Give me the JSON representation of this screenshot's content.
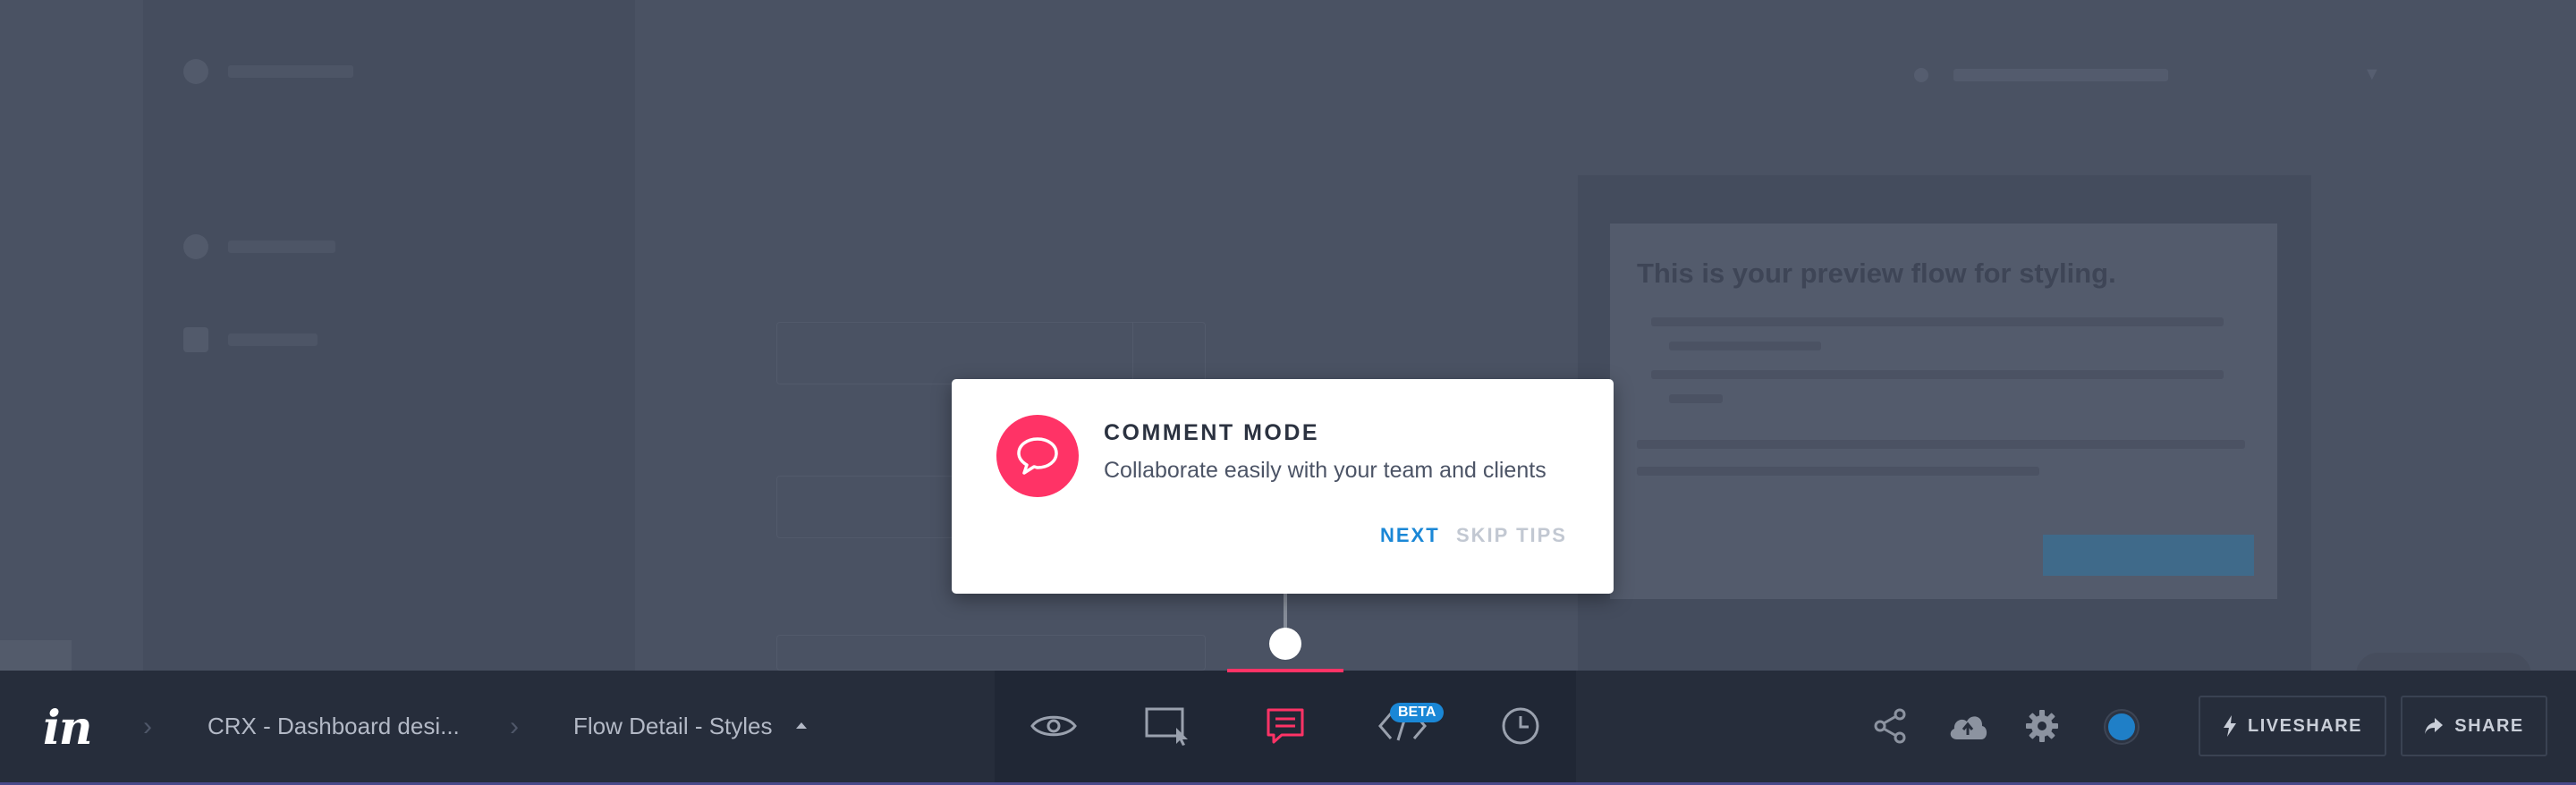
{
  "toolbar": {
    "logo": "in",
    "breadcrumb": {
      "project": "CRX - Dashboard desi...",
      "screen": "Flow Detail - Styles"
    },
    "modes": [
      {
        "name": "preview-mode",
        "icon": "eye-icon"
      },
      {
        "name": "build-mode",
        "icon": "hotspot-icon"
      },
      {
        "name": "comment-mode",
        "icon": "comment-icon",
        "active": true
      },
      {
        "name": "inspect-mode",
        "icon": "code-icon",
        "badge": "BETA"
      },
      {
        "name": "history-mode",
        "icon": "clock-icon"
      }
    ],
    "right_icons": [
      "share-nodes-icon",
      "cloud-upload-icon",
      "gear-icon"
    ],
    "liveshare_label": "LIVESHARE",
    "share_label": "SHARE"
  },
  "tip": {
    "title": "COMMENT MODE",
    "body": "Collaborate easily with your team and clients",
    "next_label": "NEXT",
    "skip_label": "SKIP TIPS"
  },
  "background_preview": {
    "title": "This is your preview flow for styling."
  },
  "colors": {
    "accent": "#ff3366",
    "primary_blue": "#1a87d6",
    "toolbar_bg": "#262d3b",
    "overlay_bg": "#4a5263"
  }
}
